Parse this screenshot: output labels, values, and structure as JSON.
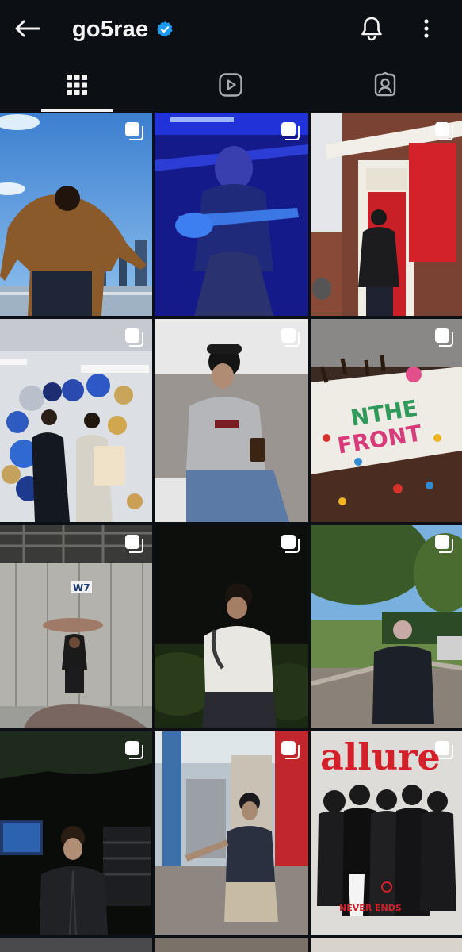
{
  "header": {
    "username": "go5rae",
    "verified": true,
    "icons": [
      "back-arrow-icon",
      "verified-badge-icon",
      "bell-icon",
      "more-vertical-icon"
    ]
  },
  "tabs": [
    {
      "name": "grid",
      "icon": "grid-icon",
      "active": true
    },
    {
      "name": "reels",
      "icon": "reels-icon",
      "active": false
    },
    {
      "name": "tagged",
      "icon": "tagged-person-icon",
      "active": false
    }
  ],
  "posts": [
    {
      "id": 1,
      "description": "man in brown jacket by river railing",
      "multi": true
    },
    {
      "id": 2,
      "description": "guitarist under blue stage light",
      "multi": true
    },
    {
      "id": 3,
      "description": "man in black jacket by red door",
      "multi": true
    },
    {
      "id": 4,
      "description": "two people with balloon arch",
      "multi": true
    },
    {
      "id": 5,
      "description": "man in grey hoodie on couch",
      "multi": true
    },
    {
      "id": 6,
      "description": "cake with candy letters",
      "multi": true
    },
    {
      "id": 7,
      "description": "man lifting rock prop",
      "multi": true
    },
    {
      "id": 8,
      "description": "man in white tee at night",
      "multi": true
    },
    {
      "id": 9,
      "description": "man in black tee under trees",
      "multi": true
    },
    {
      "id": 10,
      "description": "man in black suit backstage",
      "multi": true
    },
    {
      "id": 11,
      "description": "man in cap on street",
      "multi": true
    },
    {
      "id": 12,
      "description": "magazine cover group",
      "multi": true
    }
  ],
  "overlays": {
    "cake_text_line1": "NTHE",
    "cake_text_line2": "FRONT",
    "sign_w7": "W7",
    "magazine_title": "allure",
    "magazine_sub": "NEVER ENDS"
  },
  "colors": {
    "background": "#0c0f14",
    "verified_blue": "#1d9bf0",
    "text": "#f2f2f2"
  }
}
